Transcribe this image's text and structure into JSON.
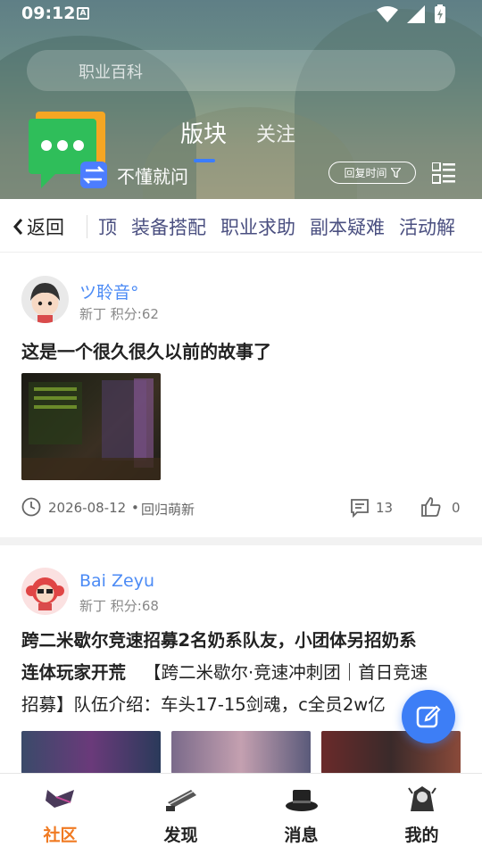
{
  "status_bar": {
    "time": "09:12",
    "notification_badge": "A"
  },
  "search": {
    "placeholder": "职业百科"
  },
  "header": {
    "section_name": "不懂就问",
    "tabs": [
      {
        "label": "版块",
        "active": true
      },
      {
        "label": "关注",
        "active": false
      }
    ],
    "sort_label": "回复时间",
    "accent_color": "#3b7dff"
  },
  "category_bar": {
    "back_label": "返回",
    "tabs": [
      "顶",
      "装备搭配",
      "职业求助",
      "副本疑难",
      "活动解"
    ]
  },
  "posts": [
    {
      "username": "ツ聆音°",
      "rank": "新丁",
      "points_label": "积分:62",
      "title": "这是一个很久很久以前的故事了",
      "date": "2026-08-12",
      "source": "回归萌新",
      "comments": "13",
      "likes": "0"
    },
    {
      "username": "Bai Zeyu",
      "rank": "新丁",
      "points_label": "积分:68",
      "title": "跨二米歇尔竞速招募2名奶系队友，小团体另招奶系",
      "title_line2": "连体玩家开荒",
      "body_line1": "【跨二米歇尔·竞速冲刺团｜首日竞速",
      "body_line2": "招募】队伍介绍：车头17-15剑魂，c全员2w亿"
    }
  ],
  "bottom_nav": [
    {
      "label": "社区",
      "icon": "community-icon",
      "active": true
    },
    {
      "label": "发现",
      "icon": "discover-icon",
      "active": false
    },
    {
      "label": "消息",
      "icon": "messages-icon",
      "active": false
    },
    {
      "label": "我的",
      "icon": "profile-icon",
      "active": false
    }
  ],
  "colors": {
    "link_blue": "#4c8bf5",
    "active_orange": "#f07a22",
    "fab_blue": "#3d7ef6"
  }
}
